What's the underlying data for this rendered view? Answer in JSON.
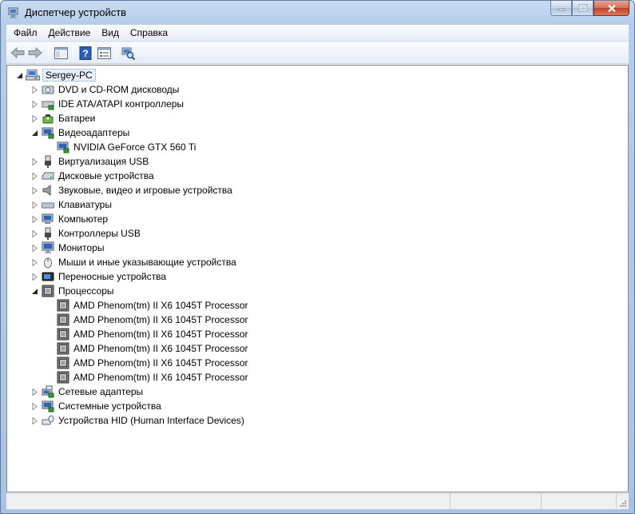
{
  "window": {
    "title": "Диспетчер устройств"
  },
  "menu": [
    "Файл",
    "Действие",
    "Вид",
    "Справка"
  ],
  "toolbar": {
    "buttons": [
      {
        "name": "back-button",
        "icon": "arrow-left-icon"
      },
      {
        "name": "forward-button",
        "icon": "arrow-right-icon"
      },
      {
        "name": "show-hide-console-tree-button",
        "icon": "console-tree-icon"
      },
      {
        "name": "help-button",
        "icon": "help-icon"
      },
      {
        "name": "properties-button",
        "icon": "properties-icon"
      },
      {
        "name": "scan-hardware-button",
        "icon": "scan-hardware-icon"
      }
    ]
  },
  "tree": {
    "root": "Sergey-PC",
    "nodes": [
      {
        "label": "DVD и CD-ROM дисководы",
        "icon": "dvd-drive-icon",
        "expanded": false
      },
      {
        "label": "IDE ATA/ATAPI контроллеры",
        "icon": "ide-controller-icon",
        "expanded": false
      },
      {
        "label": "Батареи",
        "icon": "battery-icon",
        "expanded": false
      },
      {
        "label": "Видеоадаптеры",
        "icon": "display-adapter-icon",
        "expanded": true,
        "children": [
          {
            "label": "NVIDIA GeForce GTX 560 Ti",
            "icon": "display-adapter-icon"
          }
        ]
      },
      {
        "label": "Виртуализация USB",
        "icon": "usb-icon",
        "expanded": false
      },
      {
        "label": "Дисковые устройства",
        "icon": "disk-drive-icon",
        "expanded": false
      },
      {
        "label": "Звуковые, видео и игровые устройства",
        "icon": "speaker-icon",
        "expanded": false
      },
      {
        "label": "Клавиатуры",
        "icon": "keyboard-icon",
        "expanded": false
      },
      {
        "label": "Компьютер",
        "icon": "computer-icon",
        "expanded": false
      },
      {
        "label": "Контроллеры USB",
        "icon": "usb-icon",
        "expanded": false
      },
      {
        "label": "Мониторы",
        "icon": "monitor-icon",
        "expanded": false
      },
      {
        "label": "Мыши и иные указывающие устройства",
        "icon": "mouse-icon",
        "expanded": false
      },
      {
        "label": "Переносные устройства",
        "icon": "portable-device-icon",
        "expanded": false
      },
      {
        "label": "Процессоры",
        "icon": "processor-icon",
        "expanded": true,
        "children": [
          {
            "label": "AMD Phenom(tm) II X6 1045T Processor",
            "icon": "processor-icon"
          },
          {
            "label": "AMD Phenom(tm) II X6 1045T Processor",
            "icon": "processor-icon"
          },
          {
            "label": "AMD Phenom(tm) II X6 1045T Processor",
            "icon": "processor-icon"
          },
          {
            "label": "AMD Phenom(tm) II X6 1045T Processor",
            "icon": "processor-icon"
          },
          {
            "label": "AMD Phenom(tm) II X6 1045T Processor",
            "icon": "processor-icon"
          },
          {
            "label": "AMD Phenom(tm) II X6 1045T Processor",
            "icon": "processor-icon"
          }
        ]
      },
      {
        "label": "Сетевые адаптеры",
        "icon": "network-adapter-icon",
        "expanded": false
      },
      {
        "label": "Системные устройства",
        "icon": "system-device-icon",
        "expanded": false
      },
      {
        "label": "Устройства HID (Human Interface Devices)",
        "icon": "hid-icon",
        "expanded": false
      }
    ]
  },
  "colors": {
    "accent": "#3399ff",
    "titlebar": "#b9d1ea",
    "close": "#c7503a"
  }
}
